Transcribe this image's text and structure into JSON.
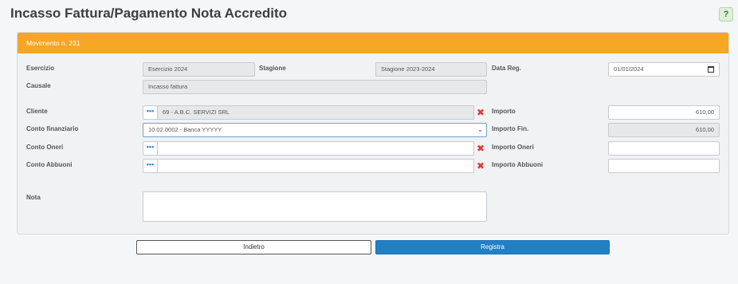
{
  "page": {
    "title": "Incasso Fattura/Pagamento Nota Accredito",
    "help_label": "?"
  },
  "panel": {
    "header": "Movimento n. 231"
  },
  "form": {
    "esercizio": {
      "label": "Esercizio",
      "value": "Esercizio 2024"
    },
    "stagione": {
      "label": "Stagione",
      "value": "Stagione 2023-2024"
    },
    "data_reg": {
      "label": "Data Reg.",
      "value": "01/01/2024"
    },
    "causale": {
      "label": "Causale",
      "value": "Incasso fattura"
    },
    "cliente": {
      "label": "Cliente",
      "value": "69 - A.B.C. SERVIZI SRL"
    },
    "importo": {
      "label": "Importo",
      "value": "610,00"
    },
    "conto_finanziario": {
      "label": "Conto finanziario",
      "value": "10.02.0002 - Banca YYYYY"
    },
    "importo_fin": {
      "label": "Importo Fin.",
      "value": "610,00"
    },
    "conto_oneri": {
      "label": "Conto Oneri",
      "value": ""
    },
    "importo_oneri": {
      "label": "Importo Oneri",
      "value": ""
    },
    "conto_abbuoni": {
      "label": "Conto Abbuoni",
      "value": ""
    },
    "importo_abbuoni": {
      "label": "Importo Abbuoni",
      "value": ""
    },
    "nota": {
      "label": "Nota",
      "value": ""
    }
  },
  "icons": {
    "dots": "•••",
    "clear": "✖",
    "caret": "⌄"
  },
  "buttons": {
    "back": "Indietro",
    "save": "Registra"
  },
  "colors": {
    "header": "#f5a623",
    "primary": "#2180c4",
    "clear": "#e53935",
    "dots": "#2a8dd4"
  }
}
